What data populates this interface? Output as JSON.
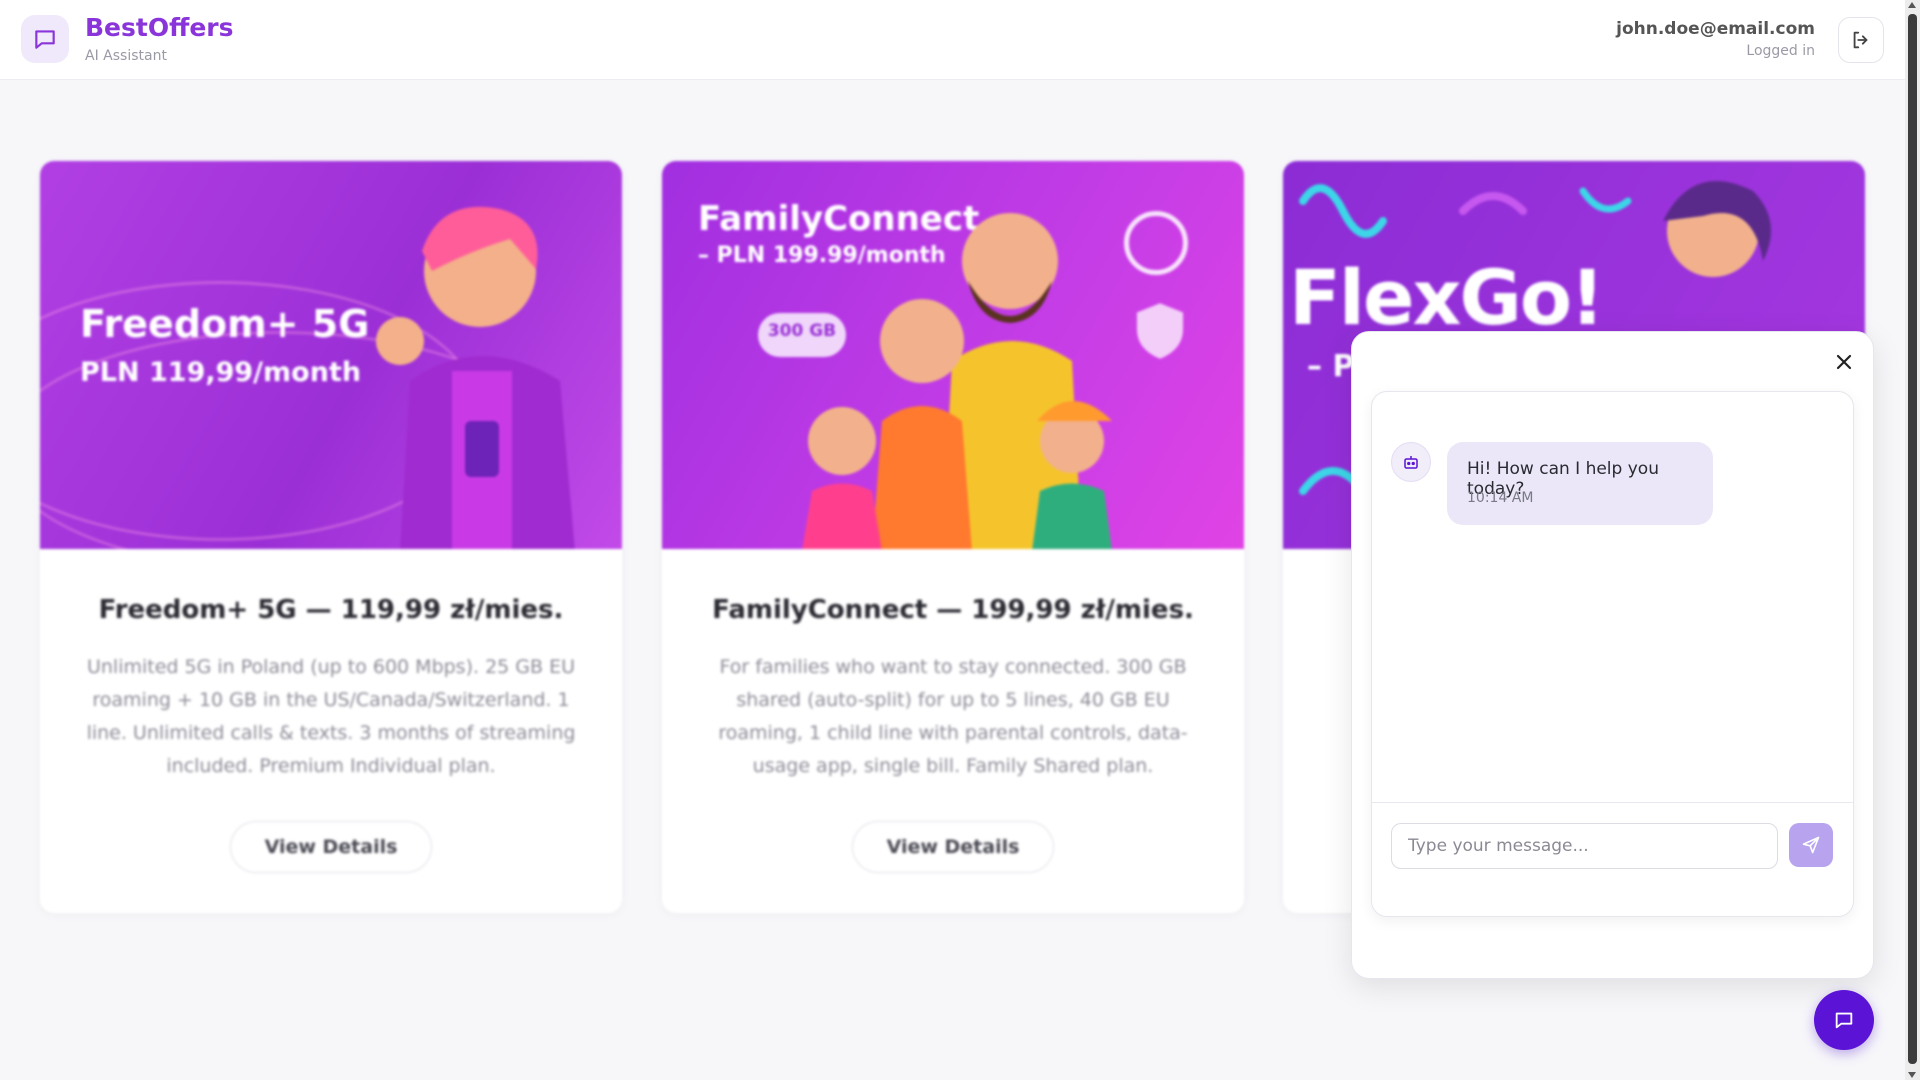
{
  "header": {
    "brand_title": "BestOffers",
    "brand_subtitle": "AI Assistant",
    "user_email": "john.doe@email.com",
    "user_status": "Logged in"
  },
  "offers": [
    {
      "image_title": "Freedom+ 5G",
      "image_subtitle": "PLN 119,99/month",
      "title": "Freedom+ 5G — 119,99 zł/mies.",
      "description": "Unlimited 5G in Poland (up to 600 Mbps). 25 GB EU roaming + 10 GB in the US/Canada/Switzerland. 1 line. Unlimited calls & texts. 3 months of streaming included. Premium Individual plan.",
      "button": "View Details"
    },
    {
      "image_title": "FamilyConnect",
      "image_subtitle": "– PLN 199.99/month",
      "image_badge": "300 GB",
      "title": "FamilyConnect — 199,99 zł/mies.",
      "description": "For families who want to stay connected. 300 GB shared (auto-split) for up to 5 lines, 40 GB EU roaming, 1 child line with parental controls, data-usage app, single bill. Family Shared plan.",
      "button": "View Details"
    },
    {
      "image_title": "FlexGo!",
      "image_subtitle": "– PL"
    }
  ],
  "chat": {
    "message": "Hi! How can I help you today?",
    "time": "10:14 AM",
    "input_placeholder": "Type your message..."
  },
  "colors": {
    "brand": "#8a35d9",
    "fab": "#5b14d6",
    "send": "#b7a3ee",
    "bubble": "#ebe7f8"
  }
}
